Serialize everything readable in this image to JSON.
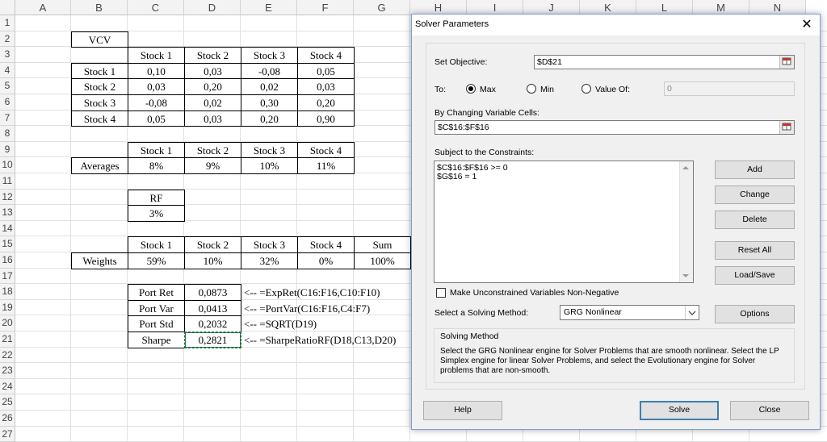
{
  "sheet": {
    "columns": [
      "A",
      "B",
      "C",
      "D",
      "E",
      "F",
      "G",
      "H",
      "I",
      "J",
      "K",
      "L",
      "M",
      "N"
    ],
    "rows": [
      "1",
      "2",
      "3",
      "4",
      "5",
      "6",
      "7",
      "8",
      "9",
      "10",
      "11",
      "12",
      "13",
      "14",
      "15",
      "16",
      "17",
      "18",
      "19",
      "20",
      "21",
      "22",
      "23",
      "24",
      "25",
      "26",
      "27"
    ],
    "vcv_label": "VCV",
    "vcv_headers": [
      "Stock 1",
      "Stock 2",
      "Stock 3",
      "Stock 4"
    ],
    "vcv_rows": [
      {
        "name": "Stock 1",
        "values": [
          "0,10",
          "0,03",
          "-0,08",
          "0,05"
        ]
      },
      {
        "name": "Stock 2",
        "values": [
          "0,03",
          "0,20",
          "0,02",
          "0,03"
        ]
      },
      {
        "name": "Stock 3",
        "values": [
          "-0,08",
          "0,02",
          "0,30",
          "0,20"
        ]
      },
      {
        "name": "Stock 4",
        "values": [
          "0,05",
          "0,03",
          "0,20",
          "0,90"
        ]
      }
    ],
    "avg_headers": [
      "Stock 1",
      "Stock 2",
      "Stock 3",
      "Stock 4"
    ],
    "avg_label": "Averages",
    "avg_values": [
      "8%",
      "9%",
      "10%",
      "11%"
    ],
    "rf_label": "RF",
    "rf_value": "3%",
    "w_headers": [
      "Stock 1",
      "Stock 2",
      "Stock 3",
      "Stock 4",
      "Sum"
    ],
    "w_label": "Weights",
    "w_values": [
      "59%",
      "10%",
      "32%",
      "0%",
      "100%"
    ],
    "results": [
      {
        "label": "Port Ret",
        "value": "0,0873",
        "formula": "<-- =ExpRet(C16:F16,C10:F10)"
      },
      {
        "label": "Port Var",
        "value": "0,0413",
        "formula": "<-- =PortVar(C16:F16,C4:F7)"
      },
      {
        "label": "Port Std",
        "value": "0,2032",
        "formula": "<-- =SQRT(D19)"
      },
      {
        "label": "Sharpe",
        "value": "0,2821",
        "formula": "<-- =SharpeRatioRF(D18,C13,D20)"
      }
    ]
  },
  "dialog": {
    "title": "Solver Parameters",
    "close_glyph": "✕",
    "set_objective_label": "Set Objective:",
    "objective_value": "$D$21",
    "to_label": "To:",
    "opt_max": "Max",
    "opt_min": "Min",
    "opt_value_of": "Value Of:",
    "value_of_field": "0",
    "changing_label": "By Changing Variable Cells:",
    "changing_value": "$C$16:$F$16",
    "constraints_label": "Subject to the Constraints:",
    "constraints": [
      "$C$16:$F$16 >= 0",
      "$G$16 = 1"
    ],
    "btn_add": "Add",
    "btn_change": "Change",
    "btn_delete": "Delete",
    "btn_reset": "Reset All",
    "btn_load": "Load/Save",
    "nonneg_label": "Make Unconstrained Variables Non-Negative",
    "method_label": "Select a Solving Method:",
    "method_value": "GRG Nonlinear",
    "btn_options": "Options",
    "solving_method_title": "Solving Method",
    "solving_method_text": "Select the GRG Nonlinear engine for Solver Problems that are smooth nonlinear. Select the LP Simplex engine for linear Solver Problems, and select the Evolutionary engine for Solver problems that are non-smooth.",
    "btn_help": "Help",
    "btn_solve": "Solve",
    "btn_close": "Close"
  }
}
